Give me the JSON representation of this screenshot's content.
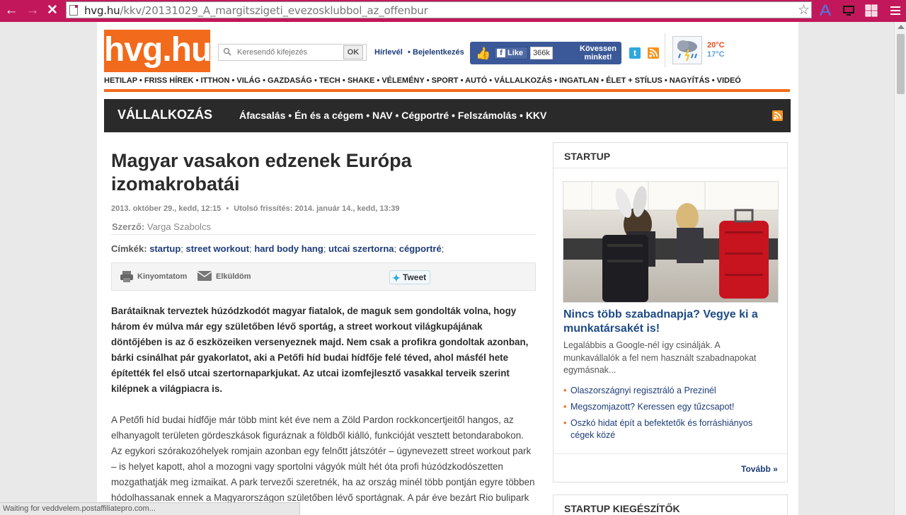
{
  "browser": {
    "url_host": "hvg.hu",
    "url_path": "/kkv/20131029_A_margitszigeti_evezosklubbol_az_offenbur",
    "status_text": "Waiting for veddvelem.postaffiliatepro.com..."
  },
  "header": {
    "logo": "hvg.hu",
    "search_placeholder": "Keresendő kifejezés",
    "ok_label": "OK",
    "hirlevel": "Hírlevél",
    "login": "Bejelentkezés",
    "fb_like": "Like",
    "fb_count": "366k",
    "fb_follow": "Kövessen minket!",
    "temp_high": "20°C",
    "temp_low": "17°C"
  },
  "topnav": [
    "HETILAP",
    "FRISS HÍREK",
    "ITTHON",
    "VILÁG",
    "GAZDASÁG",
    "TECH",
    "SHAKE",
    "VÉLEMÉNY",
    "SPORT",
    "AUTÓ",
    "VÁLLALKOZÁS",
    "INGATLAN",
    "ÉLET + STÍLUS",
    "NAGYÍTÁS",
    "VIDEÓ"
  ],
  "section": {
    "title": "VÁLLALKOZÁS",
    "links": [
      "Áfacsalás",
      "Én és a cégem",
      "NAV",
      "Cégportré",
      "Felszámolás",
      "KKV"
    ]
  },
  "article": {
    "headline": "Magyar vasakon edzenek Európa izomakrobatái",
    "date": "2013. október 29., kedd, 12:15",
    "updated_label": "Utolsó frissítés:",
    "updated": "2014. január 14., kedd, 13:39",
    "author_label": "Szerző:",
    "author": "Varga Szabolcs",
    "tags_label": "Címkék:",
    "tags": [
      "startup",
      "street workout",
      "hard body hang",
      "utcai szertorna",
      "cégportré"
    ],
    "print_label": "Kinyomtatom",
    "send_label": "Elküldöm",
    "tweet_label": "Tweet",
    "lead": "Barátaiknak terveztek húzódzkodót magyar fiatalok, de maguk sem gondolták volna, hogy három év múlva már egy születőben lévő sportág, a street workout világkupájának döntőjében is az ő eszközeiken versenyeznek majd. Nem csak a profikra gondoltak azonban, bárki csinálhat pár gyakorlatot, aki a Petőfi híd budai hídfője felé téved, ahol másfél hete építették fel első utcai szertornaparkjukat. Az utcai izomfejlesztő vasakkal terveik szerint kilépnek a világpiacra is.",
    "body": "A Petőfi híd budai hídfője már több mint két éve nem a Zöld Pardon rockkoncertjeitől hangos, az elhanyagolt területen gördeszkások figuráznak a földből kiálló, funkcióját vesztett betondarabokon. Az egykori szórakozóhelyek romjain azonban egy felnőtt játszótér – úgynevezett street workout park – is helyet kapott, ahol a mozogni vagy sportolni vágyók múlt hét óta profi húzódzkodószetten mozgathatják meg izmaikat. A park tervezői szeretnék, ha az ország minél több pontján egyre többen hódolhassanak ennek a Magyarországon születőben lévő sportágnak. A pár éve bezárt Rio bulipark helyén nyílt"
  },
  "sidebar": {
    "startup_title": "STARTUP",
    "startup_headline": "Nincs több szabadnapja? Vegye ki a munkatársakét is!",
    "startup_lead": "Legalábbis a Google-nél így csinálják. A munkavállalók a fel nem használt szabadnapokat egymásnak...",
    "links": [
      "Olaszországnyi regisztráló a Prezinél",
      "Megszomjazott? Keressen egy tűzcsapot!",
      "Oszkó hidat épít a befektetők és forráshiányos cégek közé"
    ],
    "more": "Tovább »",
    "addons_title": "STARTUP KIEGÉSZÍTŐK"
  }
}
